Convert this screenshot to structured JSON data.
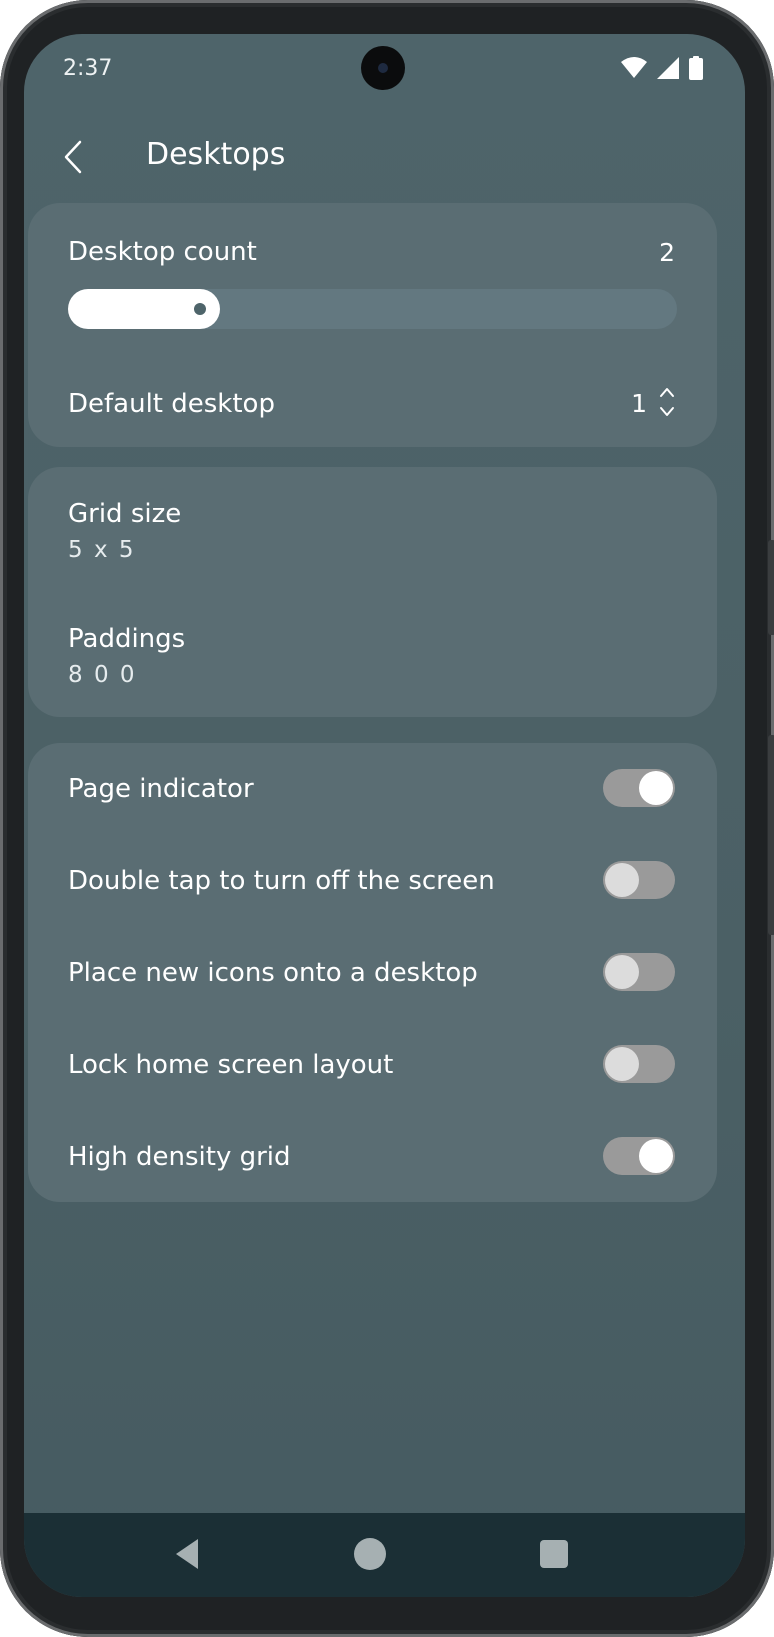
{
  "status_bar": {
    "time": "2:37",
    "icons": [
      "wifi-icon",
      "cellular-signal-icon",
      "battery-icon"
    ]
  },
  "app_bar": {
    "title": "Desktops",
    "back_icon": "chevron-left-icon"
  },
  "desktop_card": {
    "count_label": "Desktop count",
    "count_value": "2",
    "count_slider_fraction": 0.25,
    "default_label": "Default desktop",
    "default_value": "1",
    "stepper_icon": "up-down-chevron-icon"
  },
  "grid_card": {
    "grid_label": "Grid size",
    "grid_value": "5 x 5",
    "paddings_label": "Paddings",
    "paddings_value": "8 0 0"
  },
  "toggles": [
    {
      "label": "Page indicator",
      "on": true
    },
    {
      "label": "Double tap to turn off the screen",
      "on": false
    },
    {
      "label": "Place new icons onto a desktop",
      "on": false
    },
    {
      "label": "Lock home screen layout",
      "on": false
    },
    {
      "label": "High density grid",
      "on": true
    }
  ],
  "nav_bar": {
    "icons": [
      "nav-back-icon",
      "nav-home-icon",
      "nav-recents-icon"
    ]
  },
  "colors": {
    "background": "#4e646a",
    "card": "#5a6d73",
    "nav_bar": "#1b2f35",
    "toggle_track": "#9a9a9a"
  }
}
